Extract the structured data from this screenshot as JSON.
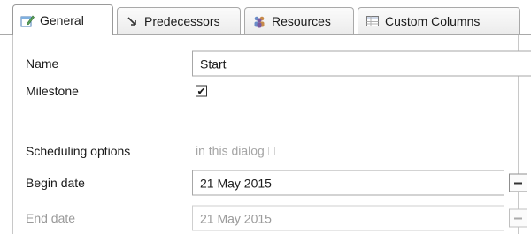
{
  "tabs": [
    {
      "label": "General",
      "icon": "general-edit-icon",
      "active": true
    },
    {
      "label": "Predecessors",
      "icon": "predecessors-arrow-icon",
      "active": false
    },
    {
      "label": "Resources",
      "icon": "resources-people-icon",
      "active": false
    },
    {
      "label": "Custom Columns",
      "icon": "custom-columns-table-icon",
      "active": false
    }
  ],
  "form": {
    "name": {
      "label": "Name",
      "value": "Start"
    },
    "milestone": {
      "label": "Milestone",
      "checked": true,
      "check_glyph": "✔"
    },
    "scheduling": {
      "label": "Scheduling options",
      "hint": "in this dialog ⎕"
    },
    "begin_date": {
      "label": "Begin date",
      "value": "21 May 2015",
      "button_icon": "minus-icon"
    },
    "end_date": {
      "label": "End date",
      "value": "21 May 2015",
      "button_icon": "minus-icon",
      "disabled": true
    }
  },
  "colors": {
    "border": "#a7a7a7",
    "disabled_text": "#9a9a9a",
    "hint_text": "#a5a5a5"
  }
}
